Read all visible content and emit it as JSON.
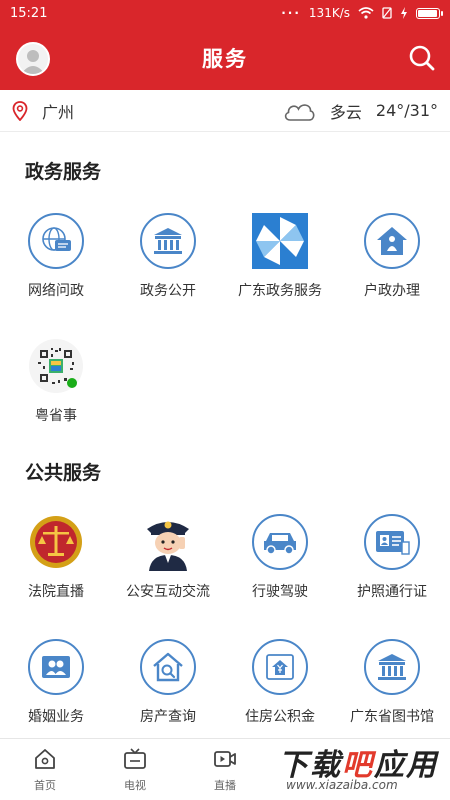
{
  "status_bar": {
    "time": "15:21",
    "speed": "131K/s",
    "dots": "···"
  },
  "header": {
    "title": "服务"
  },
  "location": {
    "city": "广州",
    "weather": "多云",
    "temp": "24°/31°"
  },
  "sections": {
    "gov": {
      "title": "政务服务",
      "items": [
        {
          "label": "网络问政",
          "icon": "chat-globe-icon"
        },
        {
          "label": "政务公开",
          "icon": "government-building-icon"
        },
        {
          "label": "广东政务服务",
          "icon": "pinwheel-logo-icon"
        },
        {
          "label": "户政办理",
          "icon": "household-house-icon"
        },
        {
          "label": "粤省事",
          "icon": "qr-code-icon"
        }
      ]
    },
    "public": {
      "title": "公共服务",
      "items": [
        {
          "label": "法院直播",
          "icon": "court-emblem-icon"
        },
        {
          "label": "公安互动交流",
          "icon": "police-officer-icon"
        },
        {
          "label": "行驶驾驶",
          "icon": "car-icon"
        },
        {
          "label": "护照通行证",
          "icon": "passport-card-icon"
        },
        {
          "label": "婚姻业务",
          "icon": "couple-photo-icon"
        },
        {
          "label": "房产查询",
          "icon": "house-search-icon"
        },
        {
          "label": "住房公积金",
          "icon": "housing-fund-icon"
        },
        {
          "label": "广东省图书馆",
          "icon": "library-building-icon"
        }
      ]
    }
  },
  "bottom_nav": [
    {
      "label": "首页",
      "icon": "home-icon"
    },
    {
      "label": "电视",
      "icon": "tv-icon"
    },
    {
      "label": "直播",
      "icon": "live-video-icon"
    }
  ],
  "watermark": {
    "big_pre": "下载",
    "big_mid": "吧",
    "big_post": "应用",
    "small": "www.xiazaiba.com"
  },
  "colors": {
    "brand_red": "#d9262b",
    "icon_blue": "#4a86c8"
  }
}
